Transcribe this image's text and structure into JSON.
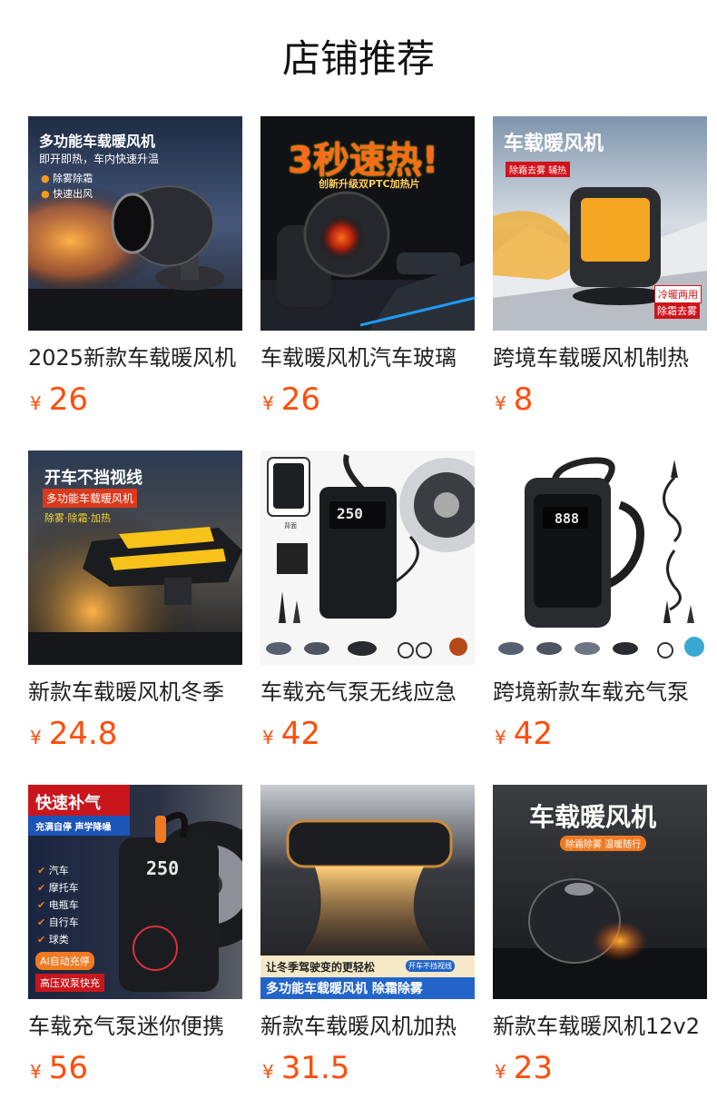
{
  "section": {
    "title": "店铺推荐"
  },
  "currency_symbol": "¥",
  "colors": {
    "price": "#ff4d0a",
    "title_text": "#222222",
    "background": "#ffffff"
  },
  "products": [
    {
      "title": "2025新款车载暖风机",
      "price": "26",
      "image": {
        "icon": "car-heater-icon",
        "headline": "多功能车载暖风机",
        "line1": "即开即热，车内快速升温",
        "bullet1": "除雾除霜",
        "bullet2": "快速出风"
      }
    },
    {
      "title": "车载暖风机汽车玻璃",
      "price": "26",
      "image": {
        "icon": "car-heater-icon",
        "headline": "3秒速热!",
        "line1": "创新升级双PTC加热片"
      }
    },
    {
      "title": "跨境车载暖风机制热",
      "price": "8",
      "image": {
        "icon": "car-heater-icon",
        "headline": "车载暖风机",
        "tag1": "除霜去雾 辅热",
        "tag2": "冷暖两用",
        "tag3": "除霜去雾"
      }
    },
    {
      "title": "新款车载暖风机冬季",
      "price": "24.8",
      "image": {
        "icon": "car-heater-icon",
        "headline": "开车不挡视线",
        "line1": "多功能车载暖风机",
        "line2": "除雾·除霜·加热"
      }
    },
    {
      "title": "车载充气泵无线应急",
      "price": "42",
      "image": {
        "icon": "air-pump-icon",
        "display": "250",
        "caption": "背面"
      }
    },
    {
      "title": "跨境新款车载充气泵",
      "price": "42",
      "image": {
        "icon": "air-pump-icon",
        "display": "888"
      }
    },
    {
      "title": "车载充气泵迷你便携",
      "price": "56",
      "image": {
        "icon": "air-pump-icon",
        "headline": "快速补气",
        "line1": "充满自停 声学降噪",
        "display": "250",
        "items": [
          "汽车",
          "摩托车",
          "电瓶车",
          "自行车",
          "球类"
        ],
        "badge1": "AI自动充停",
        "badge2": "高压双泵快充"
      }
    },
    {
      "title": "新款车载暖风机加热",
      "price": "31.5",
      "image": {
        "icon": "car-heater-icon",
        "line1": "让冬季驾驶变的更轻松",
        "tag": "开车不挡视线",
        "headline": "多功能车载暖风机 除霜除雾"
      }
    },
    {
      "title": "新款车载暖风机12v2",
      "price": "23",
      "image": {
        "icon": "car-heater-icon",
        "headline": "车载暖风机",
        "tag": "除霜除雾 温暖随行"
      }
    }
  ]
}
